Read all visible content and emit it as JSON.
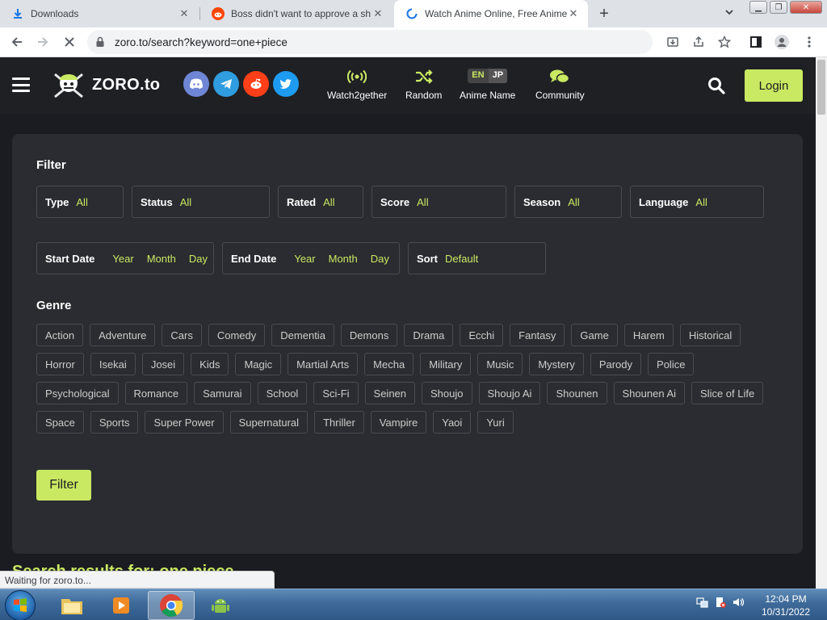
{
  "browser": {
    "tabs": [
      {
        "title": "Downloads",
        "icon": "download-icon"
      },
      {
        "title": "Boss didn't want to approve a sh",
        "icon": "reddit-icon"
      },
      {
        "title": "Watch Anime Online, Free Anime",
        "icon": "loading-icon"
      }
    ],
    "url": "zoro.to/search?keyword=one+piece"
  },
  "site": {
    "logo_text": "ZORO.to",
    "nav": [
      {
        "label": "Watch2gether",
        "icon": "broadcast-icon"
      },
      {
        "label": "Random",
        "icon": "shuffle-icon"
      },
      {
        "label": "Anime Name",
        "icon": "language-toggle-icon"
      },
      {
        "label": "Community",
        "icon": "chat-icon"
      }
    ],
    "lang_en": "EN",
    "lang_jp": "JP",
    "login_label": "Login",
    "social": [
      "discord-icon",
      "telegram-icon",
      "reddit-icon",
      "twitter-icon"
    ],
    "accent_color": "#cae962"
  },
  "filter": {
    "title": "Filter",
    "row1": [
      {
        "key": "Type",
        "value": "All"
      },
      {
        "key": "Status",
        "value": "All"
      },
      {
        "key": "Rated",
        "value": "All"
      },
      {
        "key": "Score",
        "value": "All"
      },
      {
        "key": "Season",
        "value": "All"
      },
      {
        "key": "Language",
        "value": "All"
      }
    ],
    "start_date": {
      "key": "Start Date",
      "year": "Year",
      "month": "Month",
      "day": "Day"
    },
    "end_date": {
      "key": "End Date",
      "year": "Year",
      "month": "Month",
      "day": "Day"
    },
    "sort": {
      "key": "Sort",
      "value": "Default"
    },
    "genre_title": "Genre",
    "genres": [
      [
        "Action",
        "Adventure",
        "Cars",
        "Comedy",
        "Dementia",
        "Demons",
        "Drama",
        "Ecchi",
        "Fantasy",
        "Game",
        "Harem",
        "Historical"
      ],
      [
        "Horror",
        "Isekai",
        "Josei",
        "Kids",
        "Magic",
        "Martial Arts",
        "Mecha",
        "Military",
        "Music",
        "Mystery",
        "Parody",
        "Police"
      ],
      [
        "Psychological",
        "Romance",
        "Samurai",
        "School",
        "Sci-Fi",
        "Seinen",
        "Shoujo",
        "Shoujo Ai",
        "Shounen",
        "Shounen Ai",
        "Slice of Life"
      ],
      [
        "Space",
        "Sports",
        "Super Power",
        "Supernatural",
        "Thriller",
        "Vampire",
        "Yaoi",
        "Yuri"
      ]
    ],
    "filter_button": "Filter"
  },
  "results_title": "Search results for: one piece",
  "status_text": "Waiting for zoro.to...",
  "taskbar": {
    "time": "12:04 PM",
    "date": "10/31/2022"
  }
}
